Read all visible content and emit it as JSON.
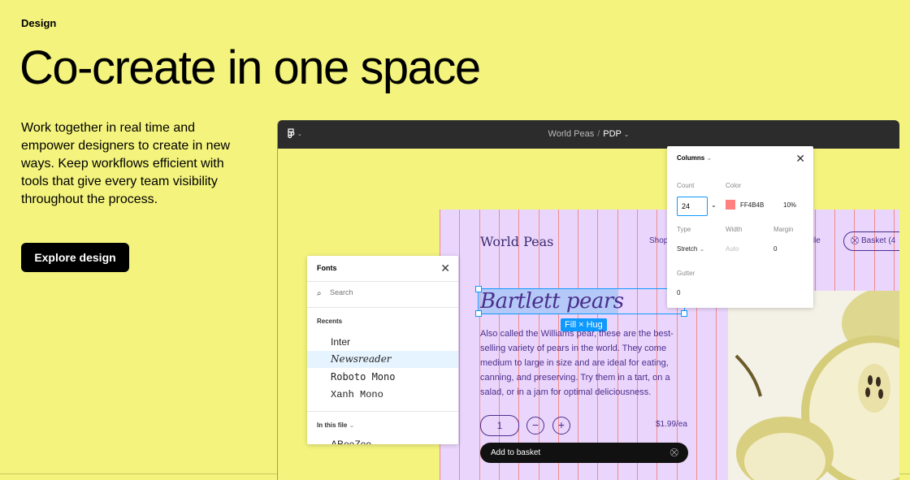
{
  "page": {
    "eyebrow": "Design",
    "title": "Co-create in one space",
    "description": "Work together in real time and empower designers to create in new ways. Keep workflows efficient with tools that give every team visibility throughout the process.",
    "cta_label": "Explore design"
  },
  "editor": {
    "file_name": "World Peas",
    "separator": "/",
    "page_name": "PDP",
    "menu_icon": "figma-logo-icon"
  },
  "design": {
    "brand": "World Peas",
    "nav_shop": "Shop",
    "nav_profile": "file",
    "basket_label": "Basket (4",
    "heading": "Bartlett pears",
    "selection_label": "Fill × Hug",
    "body": "Also called the Williams pear, these are the best-selling variety of pears in the world. They come medium to large in size and are ideal for eating, canning, and preserving. Try them in a tart, on a salad, or in a jam for optimal deliciousness.",
    "quantity": "1",
    "minus": "−",
    "plus": "+",
    "price": "$1.99/ea",
    "add_to_basket": "Add to basket"
  },
  "fonts_panel": {
    "title": "Fonts",
    "search_placeholder": "Search",
    "recents_label": "Recents",
    "recents": [
      "Inter",
      "Newsreader",
      "Roboto Mono",
      "Xanh Mono"
    ],
    "in_file_label": "In this file",
    "in_file_partial": "ABeeZee"
  },
  "columns_panel": {
    "title": "Columns",
    "count_label": "Count",
    "count_value": "24",
    "color_label": "Color",
    "color_hex": "FF4B4B",
    "color_opacity": "10%",
    "type_label": "Type",
    "type_value": "Stretch",
    "width_label": "Width",
    "width_value": "Auto",
    "margin_label": "Margin",
    "margin_value": "0",
    "gutter_label": "Gutter",
    "gutter_value": "0"
  },
  "colors": {
    "background": "#f3f37d",
    "canvas": "#ead6fc",
    "column_line": "#f28a8a",
    "selection": "#0d99ff",
    "brand_purple": "#4a2e8c"
  }
}
